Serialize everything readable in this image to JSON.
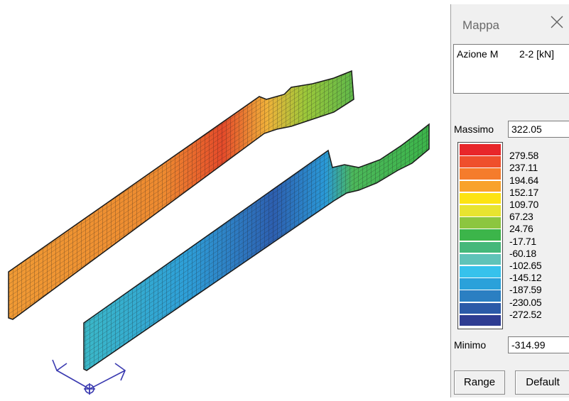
{
  "panel": {
    "title": "Mappa",
    "action_label": "Azione M",
    "action_direction": "2-2 [kN]",
    "max_label": "Massimo",
    "max_value": "322.05",
    "min_label": "Minimo",
    "min_value": "-314.99",
    "range_button": "Range",
    "default_button": "Default"
  },
  "legend": {
    "values": [
      "279.58",
      "237.11",
      "194.64",
      "152.17",
      "109.70",
      "67.23",
      "24.76",
      "-17.71",
      "-60.18",
      "-102.65",
      "-145.12",
      "-187.59",
      "-230.05",
      "-272.52"
    ],
    "colors": [
      "#e8262a",
      "#ef4f2c",
      "#f57c2c",
      "#f9a22b",
      "#fde312",
      "#e8e430",
      "#8cc63f",
      "#3cb54a",
      "#45b87a",
      "#5fc3b8",
      "#36c2ec",
      "#2aa1da",
      "#2b7fc2",
      "#2b5aa8",
      "#2e3c92"
    ]
  },
  "icons": {
    "close": "close-icon",
    "axes": "axes-gizmo-icon"
  },
  "colors": {
    "wall_far_top": "#e8d03a",
    "wall_far_bottom": "#f0a030",
    "wall_far_hot": "#e83a2a",
    "wall_near_top": "#2aa8d8",
    "wall_near_bottom": "#2f6fb2",
    "mesh_line": "#1a1a1a"
  }
}
